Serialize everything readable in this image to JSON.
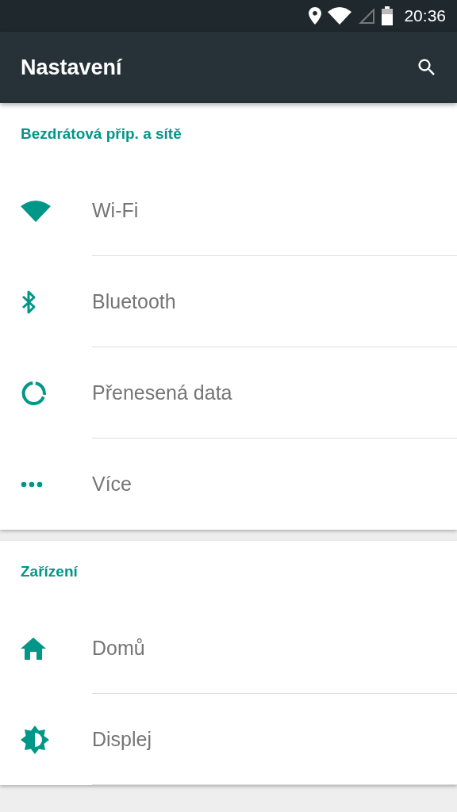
{
  "status_bar": {
    "time": "20:36"
  },
  "app_bar": {
    "title": "Nastavení"
  },
  "sections": [
    {
      "title": "Bezdrátová přip. a sítě",
      "items": [
        {
          "kind": "wifi",
          "label": "Wi-Fi"
        },
        {
          "kind": "bluetooth",
          "label": "Bluetooth"
        },
        {
          "kind": "data",
          "label": "Přenesená data"
        },
        {
          "kind": "more",
          "label": "Více"
        }
      ]
    },
    {
      "title": "Zařízení",
      "items": [
        {
          "kind": "home",
          "label": "Domů"
        },
        {
          "kind": "display",
          "label": "Displej"
        }
      ]
    }
  ]
}
